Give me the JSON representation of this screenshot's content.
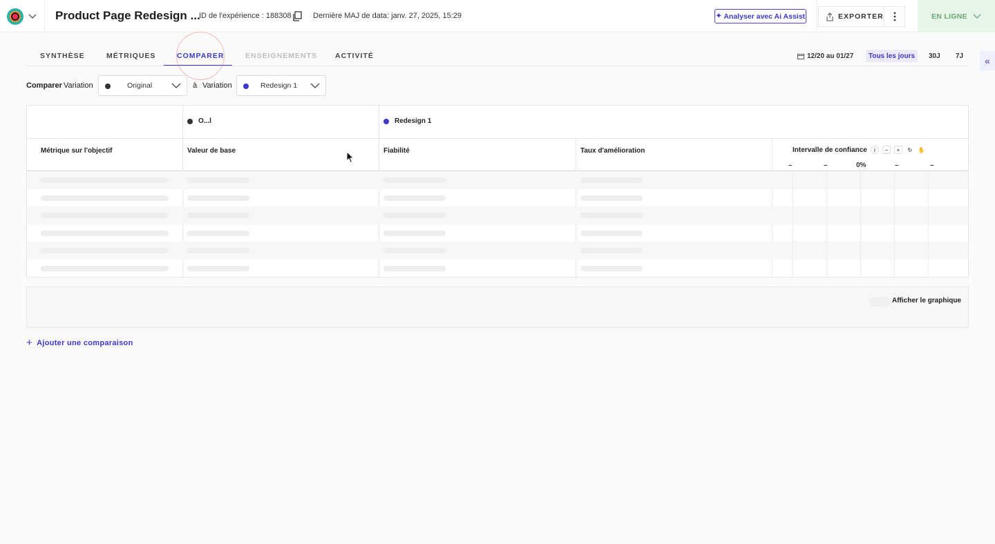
{
  "header": {
    "title": "Product Page Redesign ...",
    "experience_id": "ID de l'expérience : 188308",
    "last_update": "Dernière MAJ de data: janv. 27, 2025, 15:29",
    "ai_button": "Analyser avec Ai Assist",
    "export_button": "EXPORTER",
    "status": "EN LIGNE"
  },
  "tabs": [
    {
      "label": "SYNTHÈSE",
      "state": "normal"
    },
    {
      "label": "MÉTRIQUES",
      "state": "normal"
    },
    {
      "label": "COMPARER",
      "state": "active"
    },
    {
      "label": "ENSEIGNEMENTS",
      "state": "disabled"
    },
    {
      "label": "ACTIVITÉ",
      "state": "normal"
    }
  ],
  "date_filter": {
    "range": "12/20 au 01/27",
    "all_days": "Tous les jours",
    "d30": "30J",
    "d7": "7J"
  },
  "compare": {
    "label": "Comparer",
    "variation_label": "Variation",
    "to_label": "à",
    "variation_label_2": "Variation",
    "left_select": {
      "value": "Original",
      "color": "#333333"
    },
    "right_select": {
      "value": "Redesign 1",
      "color": "#3f37c9"
    }
  },
  "table": {
    "variation_a": {
      "name": "O...l",
      "color": "#333333"
    },
    "variation_b": {
      "name": "Redesign 1",
      "color": "#3f37c9"
    },
    "columns": {
      "metric": "Métrique sur l'objectif",
      "baseline": "Valeur de base",
      "reliability": "Fiabilité",
      "improvement": "Taux d'amélioration",
      "confidence": "Intervalle de confiance"
    },
    "ci_axis": [
      "–",
      "–",
      "0%",
      "–",
      "–"
    ]
  },
  "chart_panel": {
    "show_chart": "Afficher le graphique"
  },
  "add_comparison": "Ajouter une comparaison",
  "colors": {
    "accent": "#3f37c9",
    "status_bg": "#e8f6ea",
    "status_text": "#6aa978"
  }
}
